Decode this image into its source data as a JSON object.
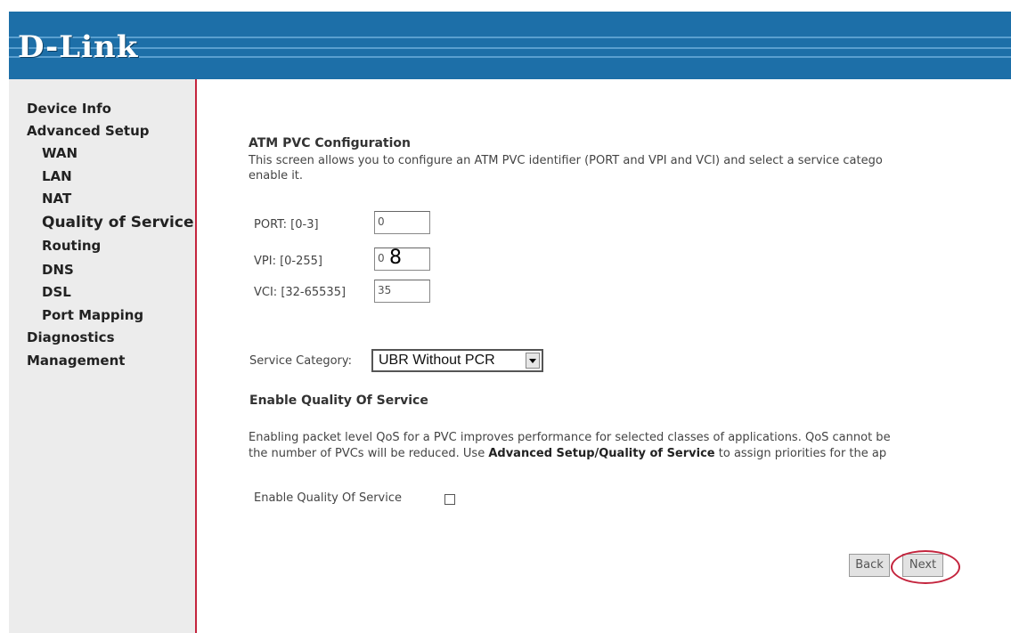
{
  "header": {
    "logo_text": "D-Link"
  },
  "sidebar": {
    "items": [
      {
        "label": "Device Info"
      },
      {
        "label": "Advanced Setup"
      },
      {
        "label": "WAN"
      },
      {
        "label": "LAN"
      },
      {
        "label": "NAT"
      },
      {
        "label": "Quality of Service"
      },
      {
        "label": "Routing"
      },
      {
        "label": "DNS"
      },
      {
        "label": "DSL"
      },
      {
        "label": "Port Mapping"
      },
      {
        "label": "Diagnostics"
      },
      {
        "label": "Management"
      }
    ]
  },
  "main": {
    "title": "ATM PVC Configuration",
    "description_line1": "This screen allows you to configure an ATM PVC identifier (PORT and VPI and VCI) and select a service catego",
    "description_line2": "enable it.",
    "port": {
      "label": "PORT: [0-3]",
      "value": "0"
    },
    "vpi": {
      "label": "VPI: [0-255]",
      "value": "0",
      "overlay_value": "8"
    },
    "vci": {
      "label": "VCI: [32-65535]",
      "value": "35"
    },
    "service_category": {
      "label": "Service Category:",
      "selected": "UBR Without PCR"
    },
    "qos": {
      "heading": "Enable Quality Of Service",
      "text_line1": "Enabling packet level QoS for a PVC improves performance for selected classes of applications.  QoS cannot be",
      "text_line2_a": "the number of PVCs will be reduced. Use ",
      "text_line2_b": "Advanced Setup/Quality of Service",
      "text_line2_c": " to assign priorities for the ap",
      "checkbox_label": "Enable Quality Of Service",
      "checked": false
    },
    "buttons": {
      "back": "Back",
      "next": "Next"
    }
  },
  "colors": {
    "header": "#1d6fa8",
    "accent": "#c4243d",
    "sidebar_bg": "#ececec"
  }
}
